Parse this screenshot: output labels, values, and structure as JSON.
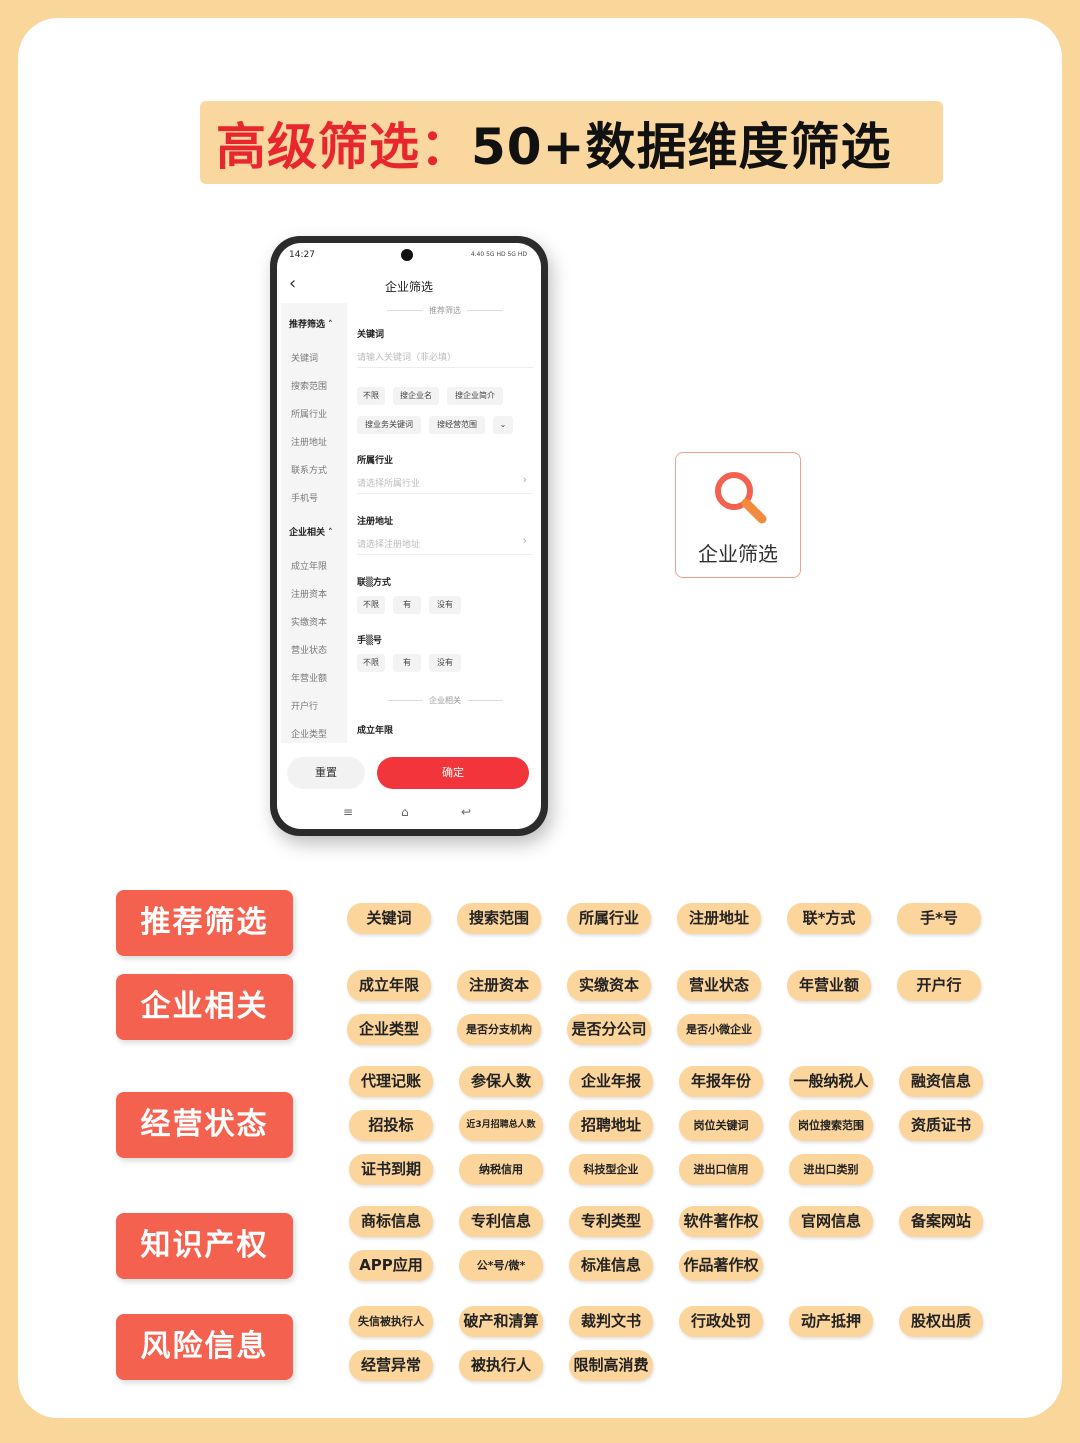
{
  "banner": {
    "red_text": "高级筛选：",
    "black_text": "50+数据维度筛选"
  },
  "phone": {
    "status_time": "14:27",
    "status_icons": "4.40 5G HD 5G HD",
    "nav_title": "企业筛选",
    "sidebar": {
      "group1": "推荐筛选",
      "group1_items": [
        "关键词",
        "搜索范围",
        "所属行业",
        "注册地址",
        "联系方式",
        "手机号"
      ],
      "group2": "企业相关",
      "group2_items": [
        "成立年限",
        "注册资本",
        "实缴资本",
        "营业状态",
        "年营业额",
        "开户行",
        "企业类型"
      ]
    },
    "main": {
      "section1": "推荐筛选",
      "keyword_label": "关键词",
      "keyword_placeholder": "请输入关键词（非必填）",
      "scope_chips": [
        "不限",
        "搜企业名",
        "搜企业简介",
        "搜业务关键词",
        "搜经营范围"
      ],
      "industry_label": "所属行业",
      "industry_placeholder": "请选择所属行业",
      "address_label": "注册地址",
      "address_placeholder": "请选择注册地址",
      "contact_label": "联▒方式",
      "contact_chips": [
        "不限",
        "有",
        "没有"
      ],
      "mobile_label": "手▒号",
      "mobile_chips": [
        "不限",
        "有",
        "没有"
      ],
      "section2": "企业相关",
      "founded_label": "成立年限"
    },
    "reset_button": "重置",
    "confirm_button": "确定"
  },
  "feature_card": {
    "label": "企业筛选"
  },
  "categories": [
    {
      "name": "推荐筛选",
      "tags": [
        "关键词",
        "搜索范围",
        "所属行业",
        "注册地址",
        "联*方式",
        "手*号"
      ]
    },
    {
      "name": "企业相关",
      "tags": [
        "成立年限",
        "注册资本",
        "实缴资本",
        "营业状态",
        "年营业额",
        "开户行",
        "企业类型",
        "是否分支机构",
        "是否分公司",
        "是否小微企业"
      ]
    },
    {
      "name": "经营状态",
      "tags": [
        "代理记账",
        "参保人数",
        "企业年报",
        "年报年份",
        "一般纳税人",
        "融资信息",
        "招投标",
        "近3月招聘总人数",
        "招聘地址",
        "岗位关键词",
        "岗位搜索范围",
        "资质证书",
        "证书到期",
        "纳税信用",
        "科技型企业",
        "进出口信用",
        "进出口类别"
      ]
    },
    {
      "name": "知识产权",
      "tags": [
        "商标信息",
        "专利信息",
        "专利类型",
        "软件著作权",
        "官网信息",
        "备案网站",
        "APP应用",
        "公*号/微*",
        "标准信息",
        "作品著作权"
      ]
    },
    {
      "name": "风险信息",
      "tags": [
        "失信被执行人",
        "破产和清算",
        "裁判文书",
        "行政处罚",
        "动产抵押",
        "股权出质",
        "经营异常",
        "被执行人",
        "限制高消费"
      ]
    }
  ],
  "colors": {
    "page_bg": "#f9d79a",
    "category_bg": "#f4614e",
    "tag_bg": "#fcd59c",
    "confirm": "#f1353a"
  }
}
